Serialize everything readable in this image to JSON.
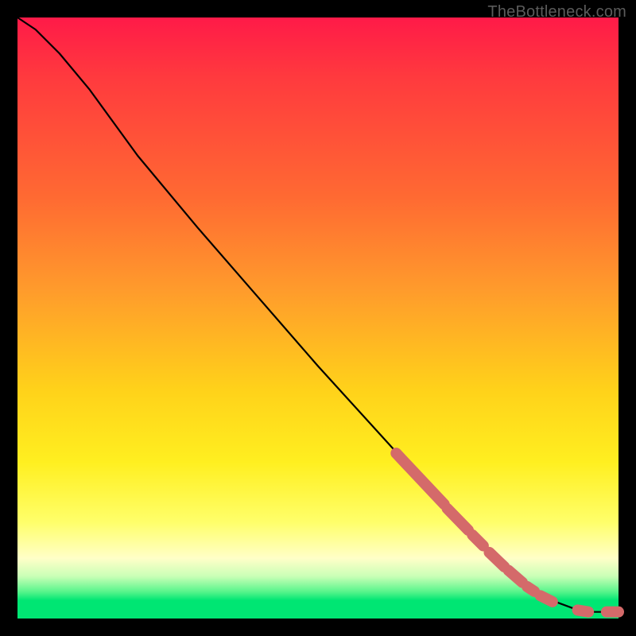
{
  "watermark": "TheBottleneck.com",
  "chart_data": {
    "type": "line",
    "title": "",
    "xlabel": "",
    "ylabel": "",
    "xlim": [
      0,
      100
    ],
    "ylim": [
      0,
      100
    ],
    "grid": false,
    "legend": false,
    "curve_points": [
      {
        "x": 0,
        "y": 100
      },
      {
        "x": 3,
        "y": 98
      },
      {
        "x": 7,
        "y": 94
      },
      {
        "x": 12,
        "y": 88
      },
      {
        "x": 20,
        "y": 77
      },
      {
        "x": 30,
        "y": 65
      },
      {
        "x": 40,
        "y": 53.5
      },
      {
        "x": 50,
        "y": 42
      },
      {
        "x": 60,
        "y": 31
      },
      {
        "x": 65,
        "y": 25.5
      },
      {
        "x": 70,
        "y": 20
      },
      {
        "x": 75,
        "y": 14.5
      },
      {
        "x": 80,
        "y": 9.5
      },
      {
        "x": 85,
        "y": 5.5
      },
      {
        "x": 90,
        "y": 2.6
      },
      {
        "x": 93,
        "y": 1.5
      },
      {
        "x": 96,
        "y": 1.1
      },
      {
        "x": 100,
        "y": 1.1
      }
    ],
    "highlight_segments": [
      {
        "x0": 63,
        "x1": 71,
        "y0": 27.5,
        "y1": 19.0
      },
      {
        "x0": 71.5,
        "x1": 75.0,
        "y0": 18.3,
        "y1": 14.7
      },
      {
        "x0": 75.7,
        "x1": 77.5,
        "y0": 13.9,
        "y1": 12.1
      },
      {
        "x0": 78.5,
        "x1": 81.0,
        "y0": 11.0,
        "y1": 8.6
      },
      {
        "x0": 81.7,
        "x1": 84.0,
        "y0": 8.0,
        "y1": 6.0
      },
      {
        "x0": 84.8,
        "x1": 86.0,
        "y0": 5.3,
        "y1": 4.5
      },
      {
        "x0": 87.0,
        "x1": 89.0,
        "y0": 3.8,
        "y1": 2.8
      },
      {
        "x0": 93.2,
        "x1": 95.0,
        "y0": 1.4,
        "y1": 1.1
      },
      {
        "x0": 98.0,
        "x1": 100,
        "y0": 1.1,
        "y1": 1.1
      }
    ],
    "colors": {
      "curve": "#000000",
      "highlight": "#d46a6a",
      "background_top": "#ff1a48",
      "background_mid": "#ffe200",
      "background_bottom": "#00e673"
    }
  }
}
